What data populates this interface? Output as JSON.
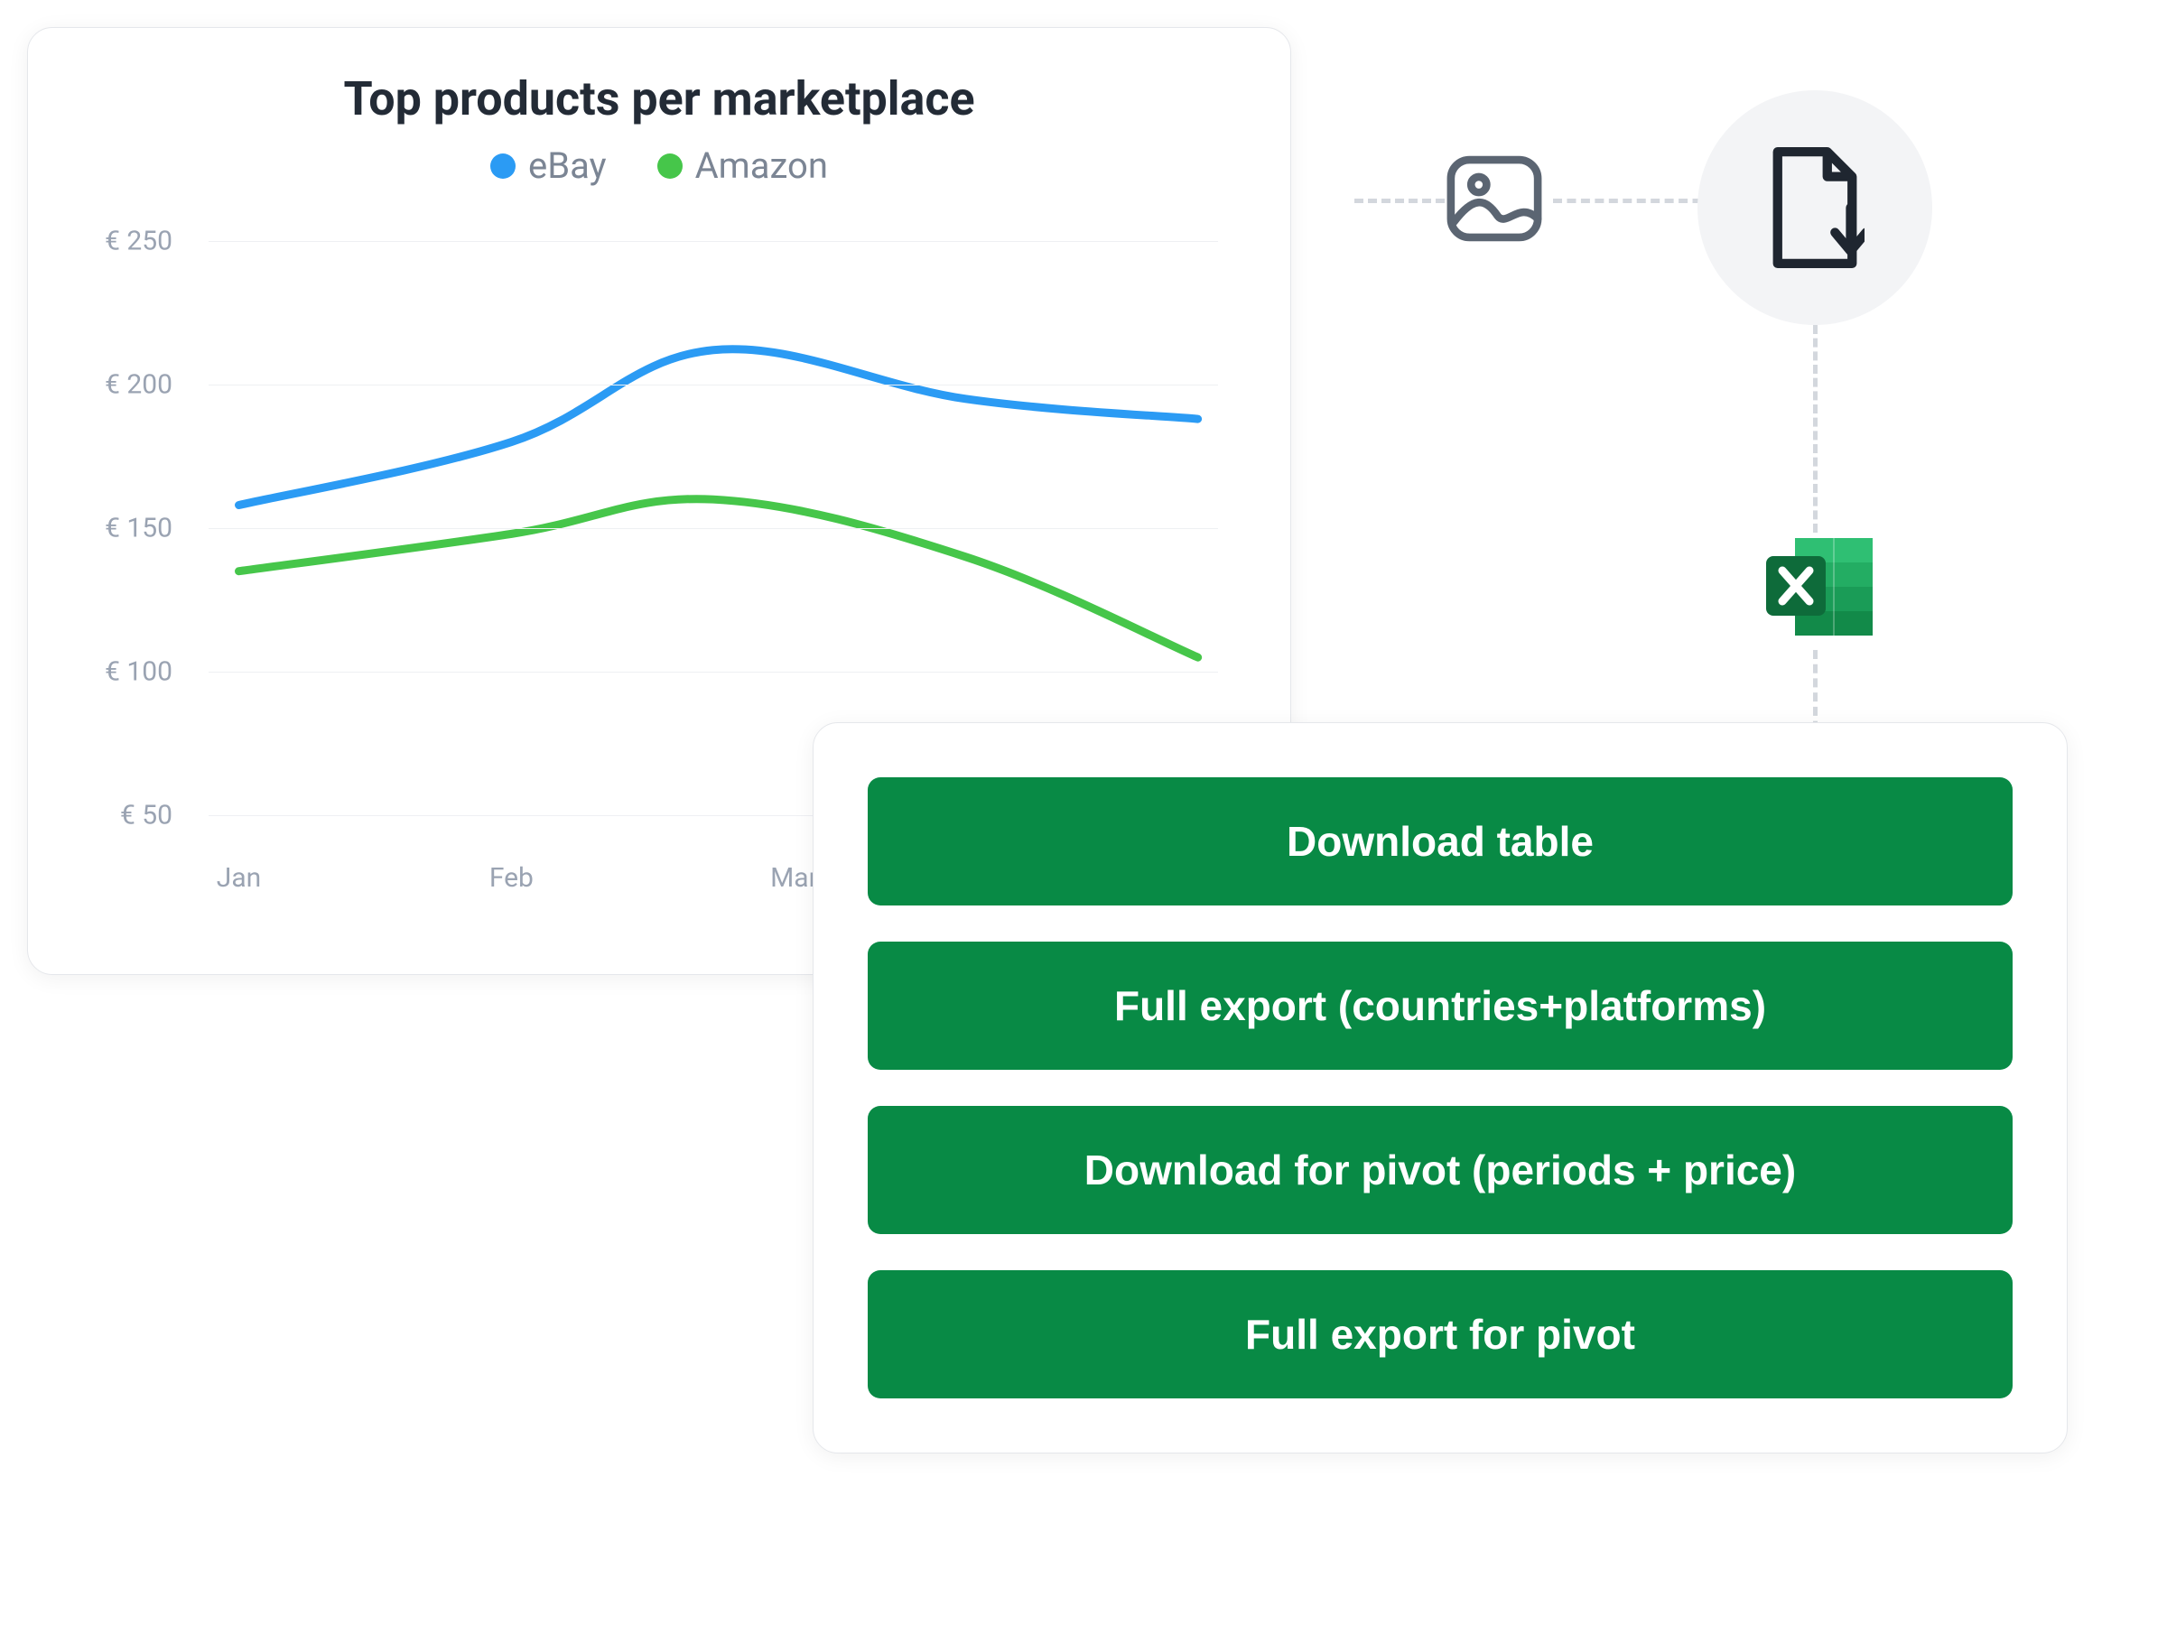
{
  "chart_data": {
    "type": "line",
    "title": "Top products per marketplace",
    "xlabel": "",
    "ylabel": "",
    "currency_prefix": "€",
    "categories": [
      "Jan",
      "Feb",
      "Mar"
    ],
    "yticks": [
      50,
      100,
      150,
      200,
      250
    ],
    "ylim": [
      40,
      260
    ],
    "series": [
      {
        "name": "eBay",
        "color": "#2b9bf4",
        "values": [
          158,
          180,
          212,
          195,
          188
        ]
      },
      {
        "name": "Amazon",
        "color": "#46c64a",
        "values": [
          135,
          148,
          160,
          140,
          105
        ]
      }
    ],
    "x_positions": [
      0.03,
      0.3,
      0.5,
      0.75,
      0.98
    ],
    "x_tick_positions": [
      0.03,
      0.3,
      0.58
    ]
  },
  "icons": {
    "image": "image-icon",
    "download_file": "file-download-icon",
    "excel": "excel-icon"
  },
  "export": {
    "buttons": [
      "Download table",
      "Full export (countries+platforms)",
      "Download for pivot (periods + price)",
      "Full export for pivot"
    ]
  },
  "colors": {
    "button_bg": "#088a45",
    "excel_dark": "#0e6b3a",
    "excel_mid": "#1a9c57",
    "excel_light": "#2fbf73",
    "icon_stroke": "#5b6572",
    "download_stroke": "#1f2630"
  }
}
